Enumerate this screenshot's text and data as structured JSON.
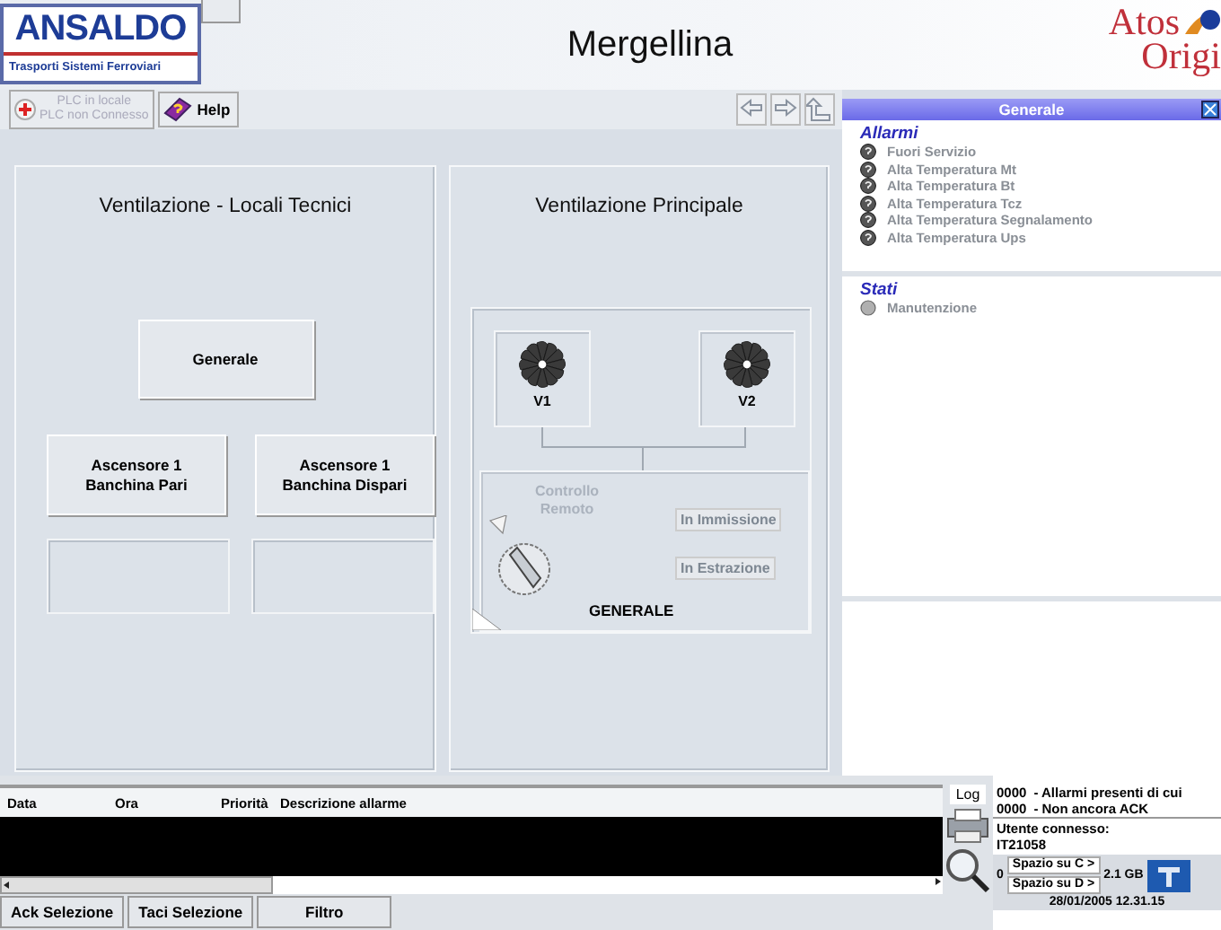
{
  "header": {
    "logo": {
      "name": "ANSALDO",
      "subtitle": "Trasporti Sistemi Ferroviari"
    },
    "title": "Mergellina",
    "partner_logo": [
      "Atos",
      "Origi"
    ]
  },
  "toolbar": {
    "plc_status": [
      "PLC in locale",
      "PLC non Connesso"
    ],
    "help": "Help"
  },
  "panels": [
    {
      "kind": "buttons",
      "title": "Ventilazione - Locali Tecnici",
      "buttons": [
        {
          "lines": [
            "Generale"
          ]
        },
        {
          "lines": [
            "Ascensore 1",
            "Banchina Pari"
          ]
        },
        {
          "lines": [
            "Ascensore 1",
            "Banchina Dispari"
          ]
        }
      ]
    },
    {
      "kind": "diagram",
      "title": "Ventilazione Principale",
      "fans": [
        {
          "label": "V1"
        },
        {
          "label": "V2"
        }
      ],
      "remote": [
        "Controllo",
        "Remoto"
      ],
      "modes": [
        {
          "label": "In Immissione",
          "active": false
        },
        {
          "label": "In Estrazione",
          "active": false
        }
      ],
      "caption": "GENERALE"
    }
  ],
  "side_panel": {
    "title": "Generale",
    "sections": [
      {
        "kind": "alarm",
        "title": "Allarmi",
        "items": [
          "Fuori Servizio",
          "Alta Temperatura Mt",
          "Alta Temperatura Bt",
          "Alta Temperatura Tcz",
          "Alta Temperatura Segnalamento",
          "Alta Temperatura Ups"
        ]
      },
      {
        "kind": "state",
        "title": "Stati",
        "items": [
          "Manutenzione"
        ]
      }
    ]
  },
  "alarm_log": {
    "columns": [
      "Data",
      "Ora",
      "Priorità",
      "Descrizione allarme"
    ],
    "buttons": [
      "Ack Selezione",
      "Taci Selezione",
      "Filtro"
    ]
  },
  "status": {
    "log": "Log",
    "counts": [
      {
        "count": "0000",
        "label": "- Allarmi presenti di cui"
      },
      {
        "count": "0000",
        "label": "- Non ancora ACK"
      }
    ],
    "user_label": "Utente connesso:",
    "user": "IT21058",
    "disk_prefix": "0",
    "disk_labels": [
      "Spazio su C >",
      "Spazio su D >"
    ],
    "disk_value": "2.1 GB",
    "datetime": "28/01/2005 12.31.15"
  }
}
